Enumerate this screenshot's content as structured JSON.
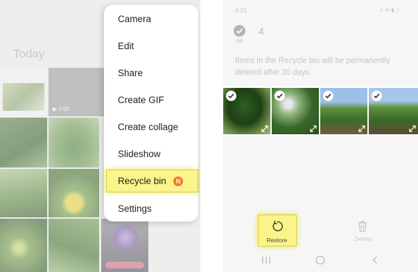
{
  "left_screen": {
    "section_title": "Today",
    "video_duration": "0:05"
  },
  "menu": {
    "items": [
      {
        "label": "Camera"
      },
      {
        "label": "Edit"
      },
      {
        "label": "Share"
      },
      {
        "label": "Create GIF"
      },
      {
        "label": "Create collage"
      },
      {
        "label": "Slideshow"
      },
      {
        "label": "Recycle bin",
        "badge": "N",
        "highlighted": true
      },
      {
        "label": "Settings"
      }
    ]
  },
  "recycle_bin": {
    "status_time": "4:01",
    "select_all_label": "All",
    "selected_count": "4",
    "message": "Items in the Recycle bin will be permanently deleted after 30 days.",
    "thumbnails": [
      {
        "checked": true
      },
      {
        "checked": true
      },
      {
        "checked": true
      },
      {
        "checked": true
      }
    ],
    "actions": {
      "restore_label": "Restore",
      "delete_label": "Delete"
    },
    "nav_icons": [
      "recent-apps-icon",
      "home-icon",
      "back-icon"
    ]
  },
  "colors": {
    "highlight": "#fbf48a",
    "badge": "#ef7d2a"
  }
}
